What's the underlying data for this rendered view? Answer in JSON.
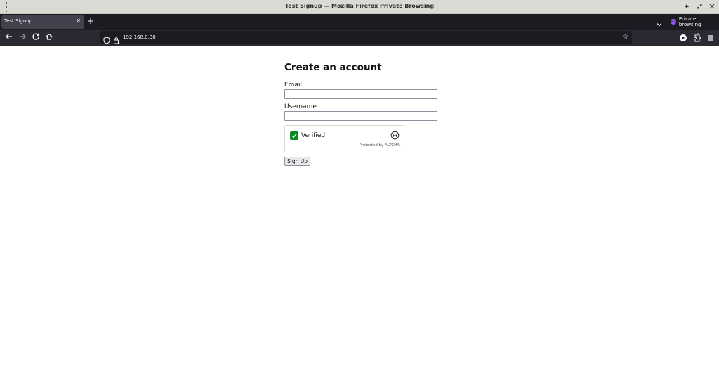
{
  "window": {
    "title": "Test Signup — Mozilla Firefox Private Browsing"
  },
  "tabs": [
    {
      "label": "Test Signup",
      "active": true
    }
  ],
  "toolbar": {
    "new_tab_symbol": "+",
    "private_label": "Private browsing",
    "url": "192.168.0.30"
  },
  "icons": {
    "back": "back-arrow-icon",
    "forward": "forward-arrow-icon",
    "reload": "reload-icon",
    "home": "home-icon",
    "shield": "tracking-protection-shield-icon",
    "lock": "insecure-lock-icon",
    "star": "bookmark-star-icon",
    "extensions": "extensions-icon",
    "menu": "hamburger-menu-icon"
  },
  "colors": {
    "accent_private": "#9059ff",
    "verified_green": "#0a8a1e"
  },
  "form": {
    "heading": "Create an account",
    "email_label": "Email",
    "email_value": "",
    "username_label": "Username",
    "username_value": "",
    "captcha": {
      "status_label": "Verified",
      "checked": true,
      "footer": "Protected by ALTCHA"
    },
    "submit_label": "Sign Up"
  }
}
